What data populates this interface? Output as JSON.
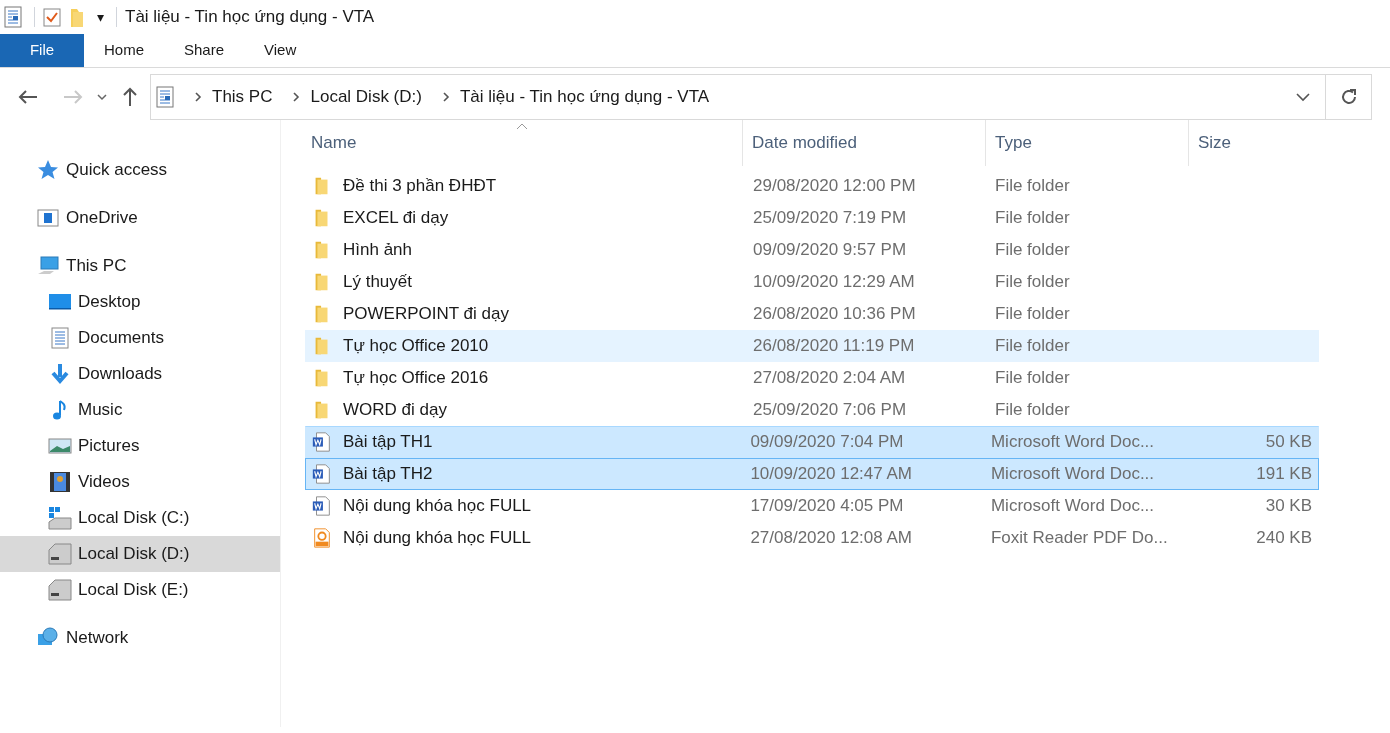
{
  "window": {
    "title": "Tài liệu - Tin học ứng dụng - VTA"
  },
  "quick_access_toolbar": {
    "dropdown_glyph": "▾"
  },
  "ribbon_tabs": [
    {
      "label": "File",
      "kind": "file"
    },
    {
      "label": "Home",
      "kind": "tab"
    },
    {
      "label": "Share",
      "kind": "tab"
    },
    {
      "label": "View",
      "kind": "tab"
    }
  ],
  "address_bar": {
    "breadcrumbs": [
      "This PC",
      "Local Disk (D:)",
      "Tài liệu - Tin học ứng dụng - VTA"
    ]
  },
  "sidebar": {
    "items": [
      {
        "label": "Quick access",
        "kind": "star",
        "selected": false
      },
      {
        "label": "OneDrive",
        "kind": "cloud",
        "selected": false
      },
      {
        "label": "This PC",
        "kind": "pc",
        "selected": false,
        "children": [
          {
            "label": "Desktop",
            "kind": "desktop",
            "selected": false
          },
          {
            "label": "Documents",
            "kind": "doc",
            "selected": false
          },
          {
            "label": "Downloads",
            "kind": "download",
            "selected": false
          },
          {
            "label": "Music",
            "kind": "music",
            "selected": false
          },
          {
            "label": "Pictures",
            "kind": "pictures",
            "selected": false
          },
          {
            "label": "Videos",
            "kind": "videos",
            "selected": false
          },
          {
            "label": "Local Disk (C:)",
            "kind": "sysdisk",
            "selected": false
          },
          {
            "label": "Local Disk (D:)",
            "kind": "disk",
            "selected": true
          },
          {
            "label": "Local Disk (E:)",
            "kind": "disk",
            "selected": false
          }
        ]
      },
      {
        "label": "Network",
        "kind": "network",
        "selected": false
      }
    ]
  },
  "table": {
    "columns": [
      "Name",
      "Date modified",
      "Type",
      "Size"
    ],
    "rows": [
      {
        "kind": "folder",
        "name": "Đề thi 3 phần ĐHĐT",
        "date": "29/08/2020 12:00 PM",
        "type": "File folder",
        "selected": false,
        "hovered": false,
        "focused": false
      },
      {
        "kind": "folder",
        "name": "EXCEL đi dạy",
        "date": "25/09/2020 7:19 PM",
        "type": "File folder",
        "selected": false,
        "hovered": false,
        "focused": false
      },
      {
        "kind": "folder",
        "name": "Hình ảnh",
        "date": "09/09/2020 9:57 PM",
        "type": "File folder",
        "selected": false,
        "hovered": false,
        "focused": false
      },
      {
        "kind": "folder",
        "name": "Lý thuyết",
        "date": "10/09/2020 12:29 AM",
        "type": "File folder",
        "selected": false,
        "hovered": false,
        "focused": false
      },
      {
        "kind": "folder",
        "name": "POWERPOINT đi dạy",
        "date": "26/08/2020 10:36 PM",
        "type": "File folder",
        "selected": false,
        "hovered": false,
        "focused": false
      },
      {
        "kind": "folder",
        "name": "Tự học Office 2010",
        "date": "26/08/2020 11:19 PM",
        "type": "File folder",
        "selected": false,
        "hovered": true,
        "focused": false
      },
      {
        "kind": "folder",
        "name": "Tự học Office 2016",
        "date": "27/08/2020 2:04 AM",
        "type": "File folder",
        "selected": false,
        "hovered": false,
        "focused": false
      },
      {
        "kind": "folder",
        "name": "WORD đi dạy",
        "date": "25/09/2020 7:06 PM",
        "type": "File folder",
        "selected": false,
        "hovered": false,
        "focused": false
      },
      {
        "kind": "word",
        "name": "Bài tập TH1",
        "date": "09/09/2020 7:04 PM",
        "type": "Microsoft Word Doc...",
        "size": "50 KB",
        "selected": true,
        "hovered": false,
        "focused": false
      },
      {
        "kind": "word",
        "name": "Bài tập TH2",
        "date": "10/09/2020 12:47 AM",
        "type": "Microsoft Word Doc...",
        "size": "191 KB",
        "selected": true,
        "hovered": false,
        "focused": true
      },
      {
        "kind": "word",
        "name": "Nội dung khóa học FULL",
        "date": "17/09/2020 4:05 PM",
        "type": "Microsoft Word Doc...",
        "size": "30 KB",
        "selected": false,
        "hovered": false,
        "focused": false
      },
      {
        "kind": "pdf",
        "name": "Nội dung khóa học FULL",
        "date": "27/08/2020 12:08 AM",
        "type": "Foxit Reader PDF Do...",
        "size": "240 KB",
        "selected": false,
        "hovered": false,
        "focused": false
      }
    ]
  }
}
